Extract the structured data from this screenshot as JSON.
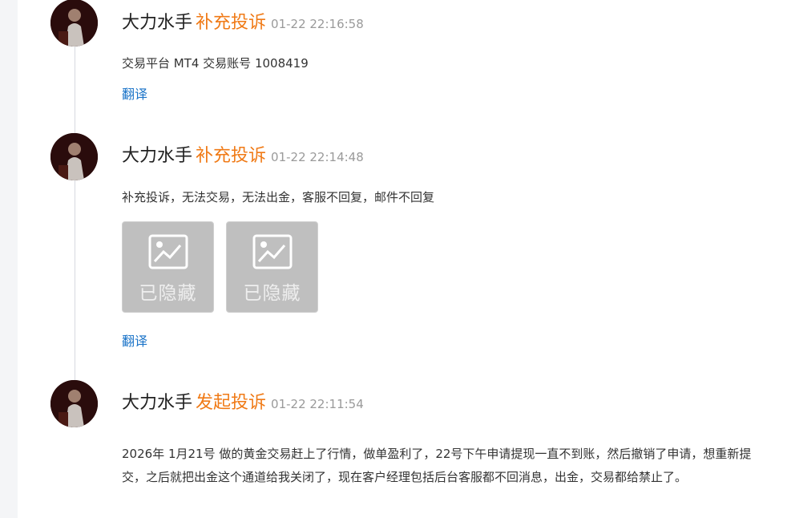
{
  "entries": [
    {
      "user": "大力水手",
      "action": "补充投诉",
      "time": "01-22 22:16:58",
      "text": "交易平台 MT4 交易账号 1008419",
      "translate": "翻译"
    },
    {
      "user": "大力水手",
      "action": "补充投诉",
      "time": "01-22 22:14:48",
      "text": "补充投诉，无法交易，无法出金，客服不回复，邮件不回复",
      "images": [
        {
          "label": "已隐藏",
          "icon": "image-placeholder-icon"
        },
        {
          "label": "已隐藏",
          "icon": "image-placeholder-icon"
        }
      ],
      "translate": "翻译"
    },
    {
      "user": "大力水手",
      "action": "发起投诉",
      "time": "01-22 22:11:54",
      "text": "2026年 1月21号 做的黄金交易赶上了行情，做单盈利了，22号下午申请提现一直不到账，然后撤销了申请，想重新提交，之后就把出金这个通道给我关闭了，现在客户经理包括后台客服都不回消息，出金，交易都给禁止了。"
    }
  ],
  "colors": {
    "action": "#f07a16",
    "link": "#1a73c8",
    "time": "#9a9a9a"
  }
}
